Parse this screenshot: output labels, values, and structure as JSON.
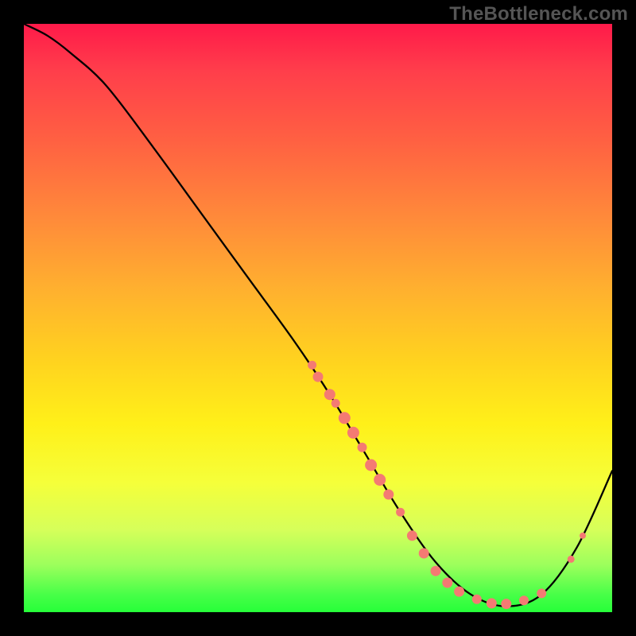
{
  "watermark": "TheBottleneck.com",
  "chart_data": {
    "type": "line",
    "title": "",
    "xlabel": "",
    "ylabel": "",
    "xlim": [
      0,
      100
    ],
    "ylim": [
      0,
      100
    ],
    "grid": false,
    "background": "red-to-green vertical gradient (bottleneck severity)",
    "series": [
      {
        "name": "bottleneck-curve",
        "x": [
          0,
          4,
          8,
          14,
          22,
          30,
          38,
          46,
          52,
          58,
          64,
          70,
          76,
          82,
          88,
          94,
          100
        ],
        "y": [
          100,
          98,
          95,
          89.5,
          79,
          68,
          57,
          46,
          37,
          27,
          17,
          8.5,
          3,
          1,
          3,
          11,
          24
        ]
      }
    ],
    "markers": [
      {
        "x": 49,
        "y": 42,
        "r": 5.5
      },
      {
        "x": 50,
        "y": 40,
        "r": 6.5
      },
      {
        "x": 52,
        "y": 37,
        "r": 7
      },
      {
        "x": 53,
        "y": 35.5,
        "r": 5.5
      },
      {
        "x": 54.5,
        "y": 33,
        "r": 7.5
      },
      {
        "x": 56,
        "y": 30.5,
        "r": 7.5
      },
      {
        "x": 57.5,
        "y": 28,
        "r": 6
      },
      {
        "x": 59,
        "y": 25,
        "r": 7.5
      },
      {
        "x": 60.5,
        "y": 22.5,
        "r": 7.5
      },
      {
        "x": 62,
        "y": 20,
        "r": 6.5
      },
      {
        "x": 64,
        "y": 17,
        "r": 5.5
      },
      {
        "x": 66,
        "y": 13,
        "r": 6.5
      },
      {
        "x": 68,
        "y": 10,
        "r": 6.5
      },
      {
        "x": 70,
        "y": 7,
        "r": 6.5
      },
      {
        "x": 72,
        "y": 5,
        "r": 6.5
      },
      {
        "x": 74,
        "y": 3.5,
        "r": 6.5
      },
      {
        "x": 77,
        "y": 2.2,
        "r": 6
      },
      {
        "x": 79.5,
        "y": 1.5,
        "r": 6.5
      },
      {
        "x": 82,
        "y": 1.4,
        "r": 6.5
      },
      {
        "x": 85,
        "y": 2,
        "r": 6
      },
      {
        "x": 88,
        "y": 3.2,
        "r": 6
      },
      {
        "x": 93,
        "y": 9,
        "r": 4.5
      },
      {
        "x": 95,
        "y": 13,
        "r": 4
      }
    ]
  }
}
